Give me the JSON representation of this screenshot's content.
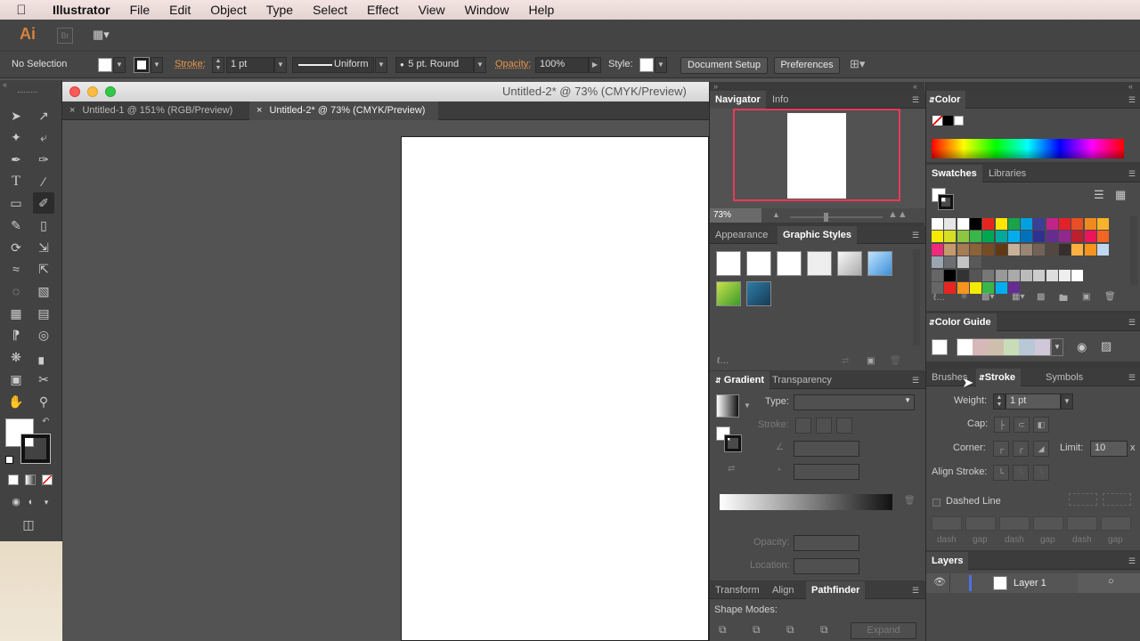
{
  "menubar": {
    "app_name": "Illustrator",
    "items": [
      "File",
      "Edit",
      "Object",
      "Type",
      "Select",
      "Effect",
      "View",
      "Window",
      "Help"
    ]
  },
  "appbar": {
    "ai_logo": "Ai",
    "br_logo": "Br"
  },
  "control_bar": {
    "selection_status": "No Selection",
    "stroke_label": "Stroke:",
    "stroke_weight": "1 pt",
    "profile_value": "Uniform",
    "brush_value": "5 pt. Round",
    "opacity_label": "Opacity:",
    "opacity_value": "100%",
    "style_label": "Style:",
    "document_setup_label": "Document Setup",
    "preferences_label": "Preferences"
  },
  "document": {
    "window_title": "Untitled-2* @ 73% (CMYK/Preview)",
    "tabs": [
      {
        "label": "Untitled-1 @ 151% (RGB/Preview)",
        "active": false
      },
      {
        "label": "Untitled-2* @ 73% (CMYK/Preview)",
        "active": true
      }
    ]
  },
  "navigator": {
    "tabs": [
      "Navigator",
      "Info"
    ],
    "zoom": "73%"
  },
  "appearance": {
    "tabs": [
      "Appearance",
      "Graphic Styles"
    ]
  },
  "gradient": {
    "tabs": [
      "Gradient",
      "Transparency"
    ],
    "type_label": "Type:",
    "stroke_label": "Stroke:",
    "opacity_label": "Opacity:",
    "location_label": "Location:"
  },
  "transform": {
    "tabs": [
      "Transform",
      "Align",
      "Pathfinder"
    ],
    "shape_modes_label": "Shape Modes:",
    "expand_label": "Expand"
  },
  "color": {
    "title": "Color"
  },
  "swatches": {
    "tabs": [
      "Swatches",
      "Libraries"
    ]
  },
  "color_guide": {
    "title": "Color Guide"
  },
  "stroke_panel": {
    "tabs": [
      "Brushes",
      "Stroke",
      "Symbols"
    ],
    "weight_label": "Weight:",
    "weight_value": "1 pt",
    "cap_label": "Cap:",
    "corner_label": "Corner:",
    "limit_label": "Limit:",
    "limit_value": "10",
    "limit_unit": "x",
    "align_stroke_label": "Align Stroke:",
    "dashed_line_label": "Dashed Line",
    "dash_labels": [
      "dash",
      "gap",
      "dash",
      "gap",
      "dash",
      "gap"
    ]
  },
  "layers": {
    "title": "Layers",
    "items": [
      {
        "name": "Layer 1"
      }
    ]
  },
  "colors": {
    "accent_orange": "#e8974a",
    "layer_color": "#4f6fe0",
    "spectrum": "rainbow"
  }
}
